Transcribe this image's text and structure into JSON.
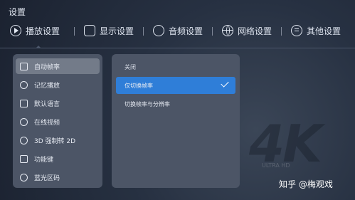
{
  "page": {
    "title": "设置"
  },
  "tabs": [
    {
      "label": "播放设置",
      "icon": "play-circle-icon"
    },
    {
      "label": "显示设置",
      "icon": "display-icon"
    },
    {
      "label": "音频设置",
      "icon": "audio-icon"
    },
    {
      "label": "网络设置",
      "icon": "globe-icon"
    },
    {
      "label": "其他设置",
      "icon": "list-icon"
    }
  ],
  "left_menu": {
    "items": [
      {
        "label": "自动帧率",
        "icon": "auto-frame-rate-icon"
      },
      {
        "label": "记忆播放",
        "icon": "clock-icon"
      },
      {
        "label": "默认语言",
        "icon": "language-icon"
      },
      {
        "label": "在线视频",
        "icon": "play-icon"
      },
      {
        "label": "3D 强制转 2D",
        "icon": "3d-icon"
      },
      {
        "label": "功能键",
        "icon": "function-key-icon"
      },
      {
        "label": "蓝光区码",
        "icon": "bluray-region-icon"
      }
    ]
  },
  "right_menu": {
    "header": "关闭",
    "options": [
      {
        "label": "仅切换帧率"
      },
      {
        "label": "切换帧率与分辨率"
      }
    ]
  },
  "background": {
    "badge": "4K",
    "badge_sub": "ULTRA HD"
  },
  "watermark": {
    "text": "知乎 @梅观戏"
  },
  "colors": {
    "selected": "#2f7ed8",
    "panel": "#4c5566"
  }
}
